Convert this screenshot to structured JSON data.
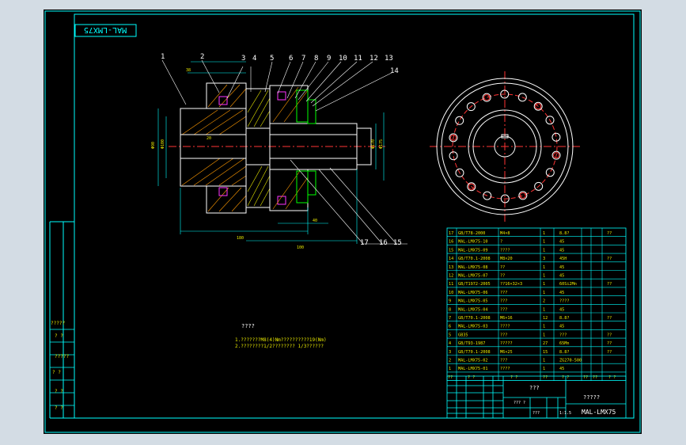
{
  "drawing_code": "MAL-LMX75",
  "balloons": [
    "1",
    "2",
    "3",
    "4",
    "5",
    "6",
    "7",
    "8",
    "9",
    "10",
    "11",
    "12",
    "13",
    "14",
    "15",
    "16",
    "17"
  ],
  "dimensions": {
    "d1": "Φ90",
    "d2": "Φ100",
    "d3": "Φ80",
    "d4": "Φ170",
    "d5": "Φ175",
    "len1": "180",
    "len2": "38",
    "len3": "40",
    "len4": "80",
    "len5": "100",
    "len6": "20",
    "len7": "30"
  },
  "tech_notes": {
    "title": "????",
    "line1": "1.???????M8(4)Nm??????????19(Nm)",
    "line2": "2.????????1/2???????? 1/3??????"
  },
  "left_stamp": [
    "?????",
    "? ?",
    "?????",
    "? ?",
    "? ?",
    "? ?"
  ],
  "bom_rows": [
    {
      "no": "17",
      "code": "GB/T78-2000",
      "name": "M4×8",
      "qty": "1",
      "mat": "8.8?",
      "note": "??"
    },
    {
      "no": "16",
      "code": "MAL-LMX75-10",
      "name": "?",
      "qty": "1",
      "mat": "45",
      "note": ""
    },
    {
      "no": "15",
      "code": "MAL-LMX75-09",
      "name": "????",
      "qty": "1",
      "mat": "45",
      "note": ""
    },
    {
      "no": "14",
      "code": "GB/T70.1-2008",
      "name": "M8×20",
      "qty": "3",
      "mat": "45H",
      "note": "??"
    },
    {
      "no": "13",
      "code": "MAL-LMX75-08",
      "name": "??",
      "qty": "1",
      "mat": "45",
      "note": ""
    },
    {
      "no": "12",
      "code": "MAL-LMX75-07",
      "name": "??",
      "qty": "1",
      "mat": "45",
      "note": ""
    },
    {
      "no": "11",
      "code": "GB/T1972-2005",
      "name": "??16×32×3",
      "qty": "1",
      "mat": "60Si2Mn",
      "note": "??"
    },
    {
      "no": "10",
      "code": "MAL-LMX75-06",
      "name": "???",
      "qty": "1",
      "mat": "45",
      "note": ""
    },
    {
      "no": "9",
      "code": "MAL-LMX75-05",
      "name": "???",
      "qty": "2",
      "mat": "????",
      "note": ""
    },
    {
      "no": "8",
      "code": "MAL-LMX75-04",
      "name": "???",
      "qty": "1",
      "mat": "45",
      "note": ""
    },
    {
      "no": "7",
      "code": "GB/T70.1-2008",
      "name": "M6×16",
      "qty": "12",
      "mat": "8.8?",
      "note": "??"
    },
    {
      "no": "6",
      "code": "MAL-LMX75-03",
      "name": "????",
      "qty": "1",
      "mat": "45",
      "note": ""
    },
    {
      "no": "5",
      "code": "GB35",
      "name": "???",
      "qty": "1",
      "mat": "???",
      "note": "??"
    },
    {
      "no": "4",
      "code": "GB/T93-1987",
      "name": "?????",
      "qty": "27",
      "mat": "65Mn",
      "note": "??"
    },
    {
      "no": "3",
      "code": "GB/T70.1-2008",
      "name": "M6×25",
      "qty": "15",
      "mat": "8.8?",
      "note": "??"
    },
    {
      "no": "2",
      "code": "MAL-LMX75-02",
      "name": "???",
      "qty": "1",
      "mat": "ZG270-500",
      "note": ""
    },
    {
      "no": "1",
      "code": "MAL-LMX75-01",
      "name": "????",
      "qty": "1",
      "mat": "45",
      "note": ""
    }
  ],
  "bom_header": {
    "no": "??",
    "code": "? ?",
    "name": "? ?",
    "qty": "??",
    "mat": "? ?",
    "w1": "??",
    "w2": "??",
    "note": "? ?"
  },
  "title_block": {
    "company": "???",
    "assembly": "?????",
    "code": "MAL-LMX75",
    "scale": "1:1",
    "sheet": "??? ?",
    "ratio": "1:1.5",
    "a": "???"
  }
}
